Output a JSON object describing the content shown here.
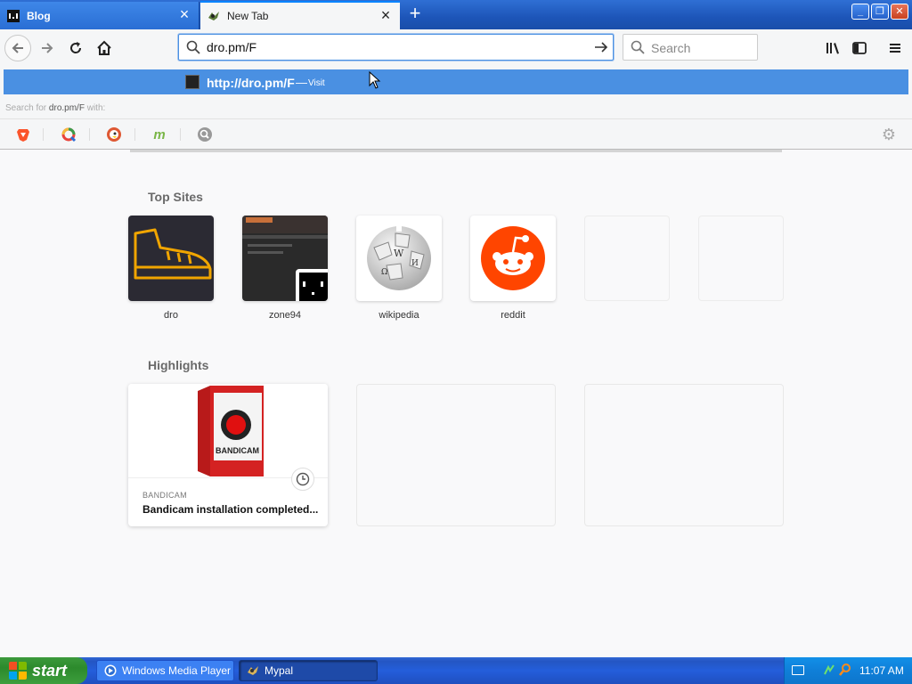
{
  "tabs": [
    {
      "title": "Blog",
      "active": false,
      "icon": "blog-favicon"
    },
    {
      "title": "New Tab",
      "active": true,
      "icon": "mypal-favicon"
    }
  ],
  "window_controls": {
    "minimize": "minimize-icon",
    "maximize": "restore-icon",
    "close": "close-icon"
  },
  "navbar": {
    "url": "dro.pm/F",
    "search_placeholder": "Search"
  },
  "dropdown": {
    "suggestion_url": "http://dro.pm/F",
    "suggestion_separator": "—",
    "suggestion_action": "Visit",
    "search_for_prefix": "Search for",
    "search_for_query": "dro.pm/F",
    "search_for_suffix": "with:",
    "engines": [
      "brave-icon",
      "qwant-icon",
      "duckduckgo-icon",
      "mojeek-icon",
      "searx-icon"
    ]
  },
  "top_sites": {
    "title": "Top Sites",
    "sites": [
      {
        "label": "dro"
      },
      {
        "label": "zone94"
      },
      {
        "label": "wikipedia"
      },
      {
        "label": "reddit"
      },
      {
        "label": ""
      },
      {
        "label": ""
      }
    ]
  },
  "highlights": {
    "title": "Highlights",
    "cards": [
      {
        "source": "BANDICAM",
        "title": "Bandicam installation completed...",
        "image_text": "BANDICAM"
      },
      {
        "source": "",
        "title": ""
      },
      {
        "source": "",
        "title": ""
      }
    ]
  },
  "taskbar": {
    "start_label": "start",
    "items": [
      {
        "label": "Windows Media Player",
        "active": false
      },
      {
        "label": "Mypal",
        "active": true
      }
    ],
    "clock": "11:07 AM"
  },
  "colors": {
    "accent": "#4a90e2",
    "reddit": "#ff4500",
    "dro_boot": "#f0a500",
    "taskbar": "#245edb",
    "start": "#3d9e3d"
  }
}
